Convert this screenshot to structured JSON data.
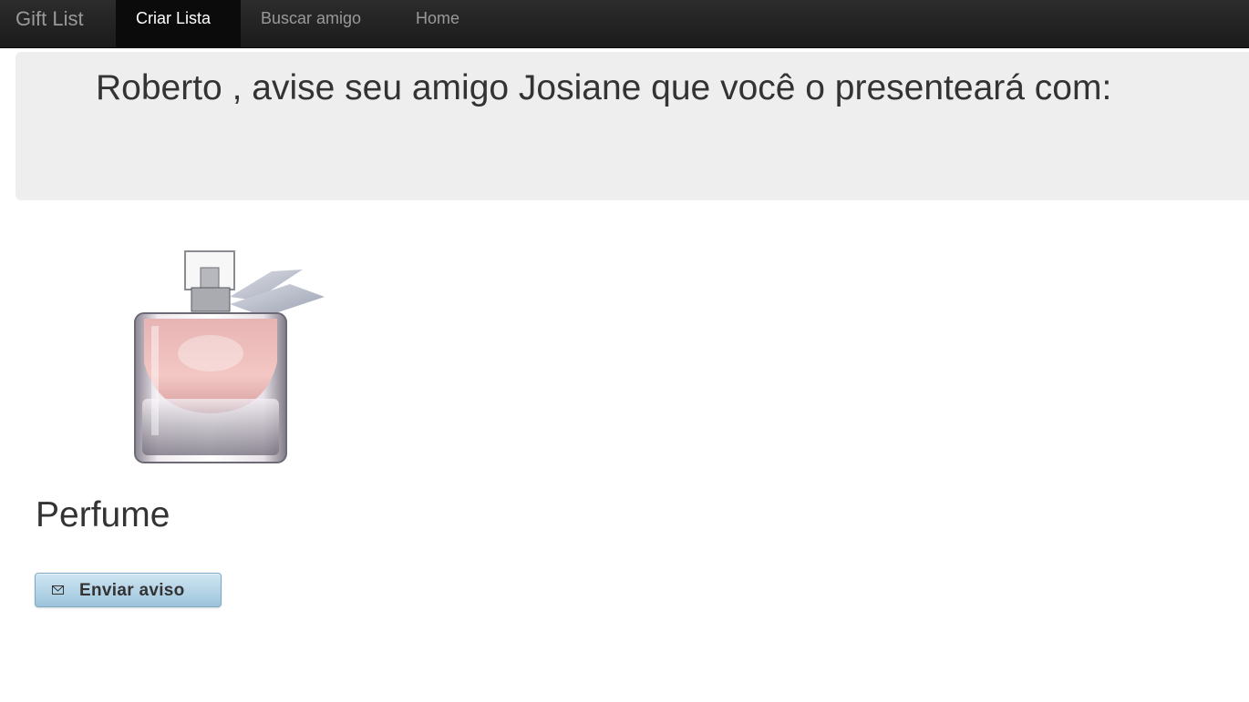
{
  "navbar": {
    "brand": "Gift List",
    "items": [
      {
        "label": "Criar Lista",
        "active": true
      },
      {
        "label": "Buscar amigo",
        "active": false
      },
      {
        "label": "Home",
        "active": false
      }
    ]
  },
  "hero": {
    "message": "Roberto , avise seu amigo Josiane que você o presenteará com:"
  },
  "product": {
    "name": "Perfume",
    "image_icon": "perfume-bottle-image"
  },
  "actions": {
    "send_label": "Enviar aviso",
    "send_icon": "envelope-icon"
  },
  "colors": {
    "navbar_bg": "#222222",
    "active_nav_bg": "#0b0b0b",
    "hero_bg": "#eeeeee",
    "button_bg": "#b5d5e8"
  }
}
